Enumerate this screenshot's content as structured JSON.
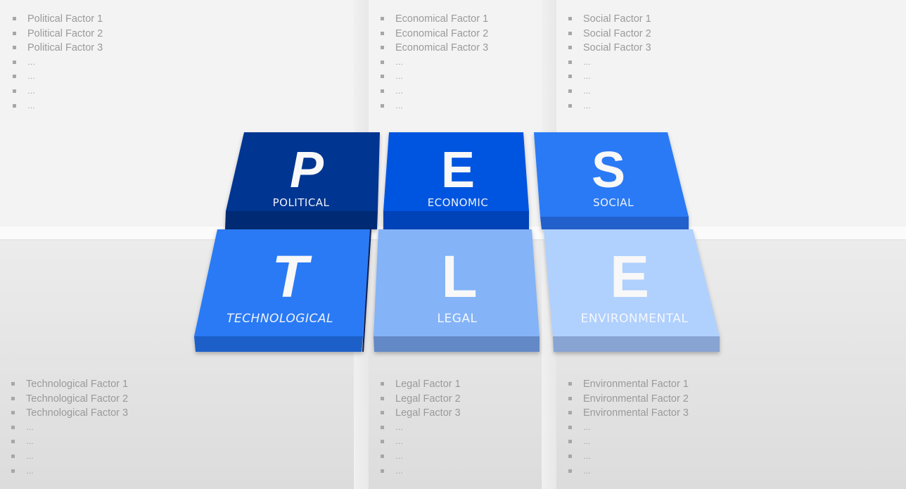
{
  "colors": {
    "political": "#003491",
    "political_side": "#002a73",
    "economic": "#0355e0",
    "economic_side": "#0343b8",
    "social": "#2c7af5",
    "social_side": "#2160cc",
    "technological": "#2c7af5",
    "technological_side": "#1f5fc8",
    "legal": "#84b3f7",
    "legal_side": "#6489c6",
    "environmental": "#b0d0fd",
    "environmental_side": "#87a4d2"
  },
  "tiles": [
    {
      "key": "political",
      "letter": "P",
      "label": "POLITICAL"
    },
    {
      "key": "economic",
      "letter": "E",
      "label": "ECONOMIC"
    },
    {
      "key": "social",
      "letter": "S",
      "label": "SOCIAL"
    },
    {
      "key": "technological",
      "letter": "T",
      "label": "TECHNOLOGICAL"
    },
    {
      "key": "legal",
      "letter": "L",
      "label": "LEGAL"
    },
    {
      "key": "environmental",
      "letter": "E",
      "label": "ENVIRONMENTAL"
    }
  ],
  "panels": {
    "political": [
      "Political Factor 1",
      "Political Factor 2",
      "Political Factor 3",
      "…",
      "…",
      "…",
      "…"
    ],
    "economic": [
      "Economical Factor 1",
      "Economical Factor 2",
      "Economical Factor 3",
      "…",
      "…",
      "…",
      "…"
    ],
    "social": [
      "Social Factor 1",
      "Social Factor 2",
      "Social Factor 3",
      "…",
      "…",
      "…",
      "…"
    ],
    "technological": [
      "Technological Factor 1",
      "Technological Factor 2",
      "Technological Factor 3",
      "…",
      "…",
      "…",
      "…"
    ],
    "legal": [
      "Legal Factor 1",
      "Legal Factor 2",
      "Legal Factor 3",
      "…",
      "…",
      "…",
      "…"
    ],
    "environmental": [
      "Environmental Factor 1",
      "Environmental Factor 2",
      "Environmental Factor 3",
      "…",
      "…",
      "…",
      "…"
    ]
  }
}
